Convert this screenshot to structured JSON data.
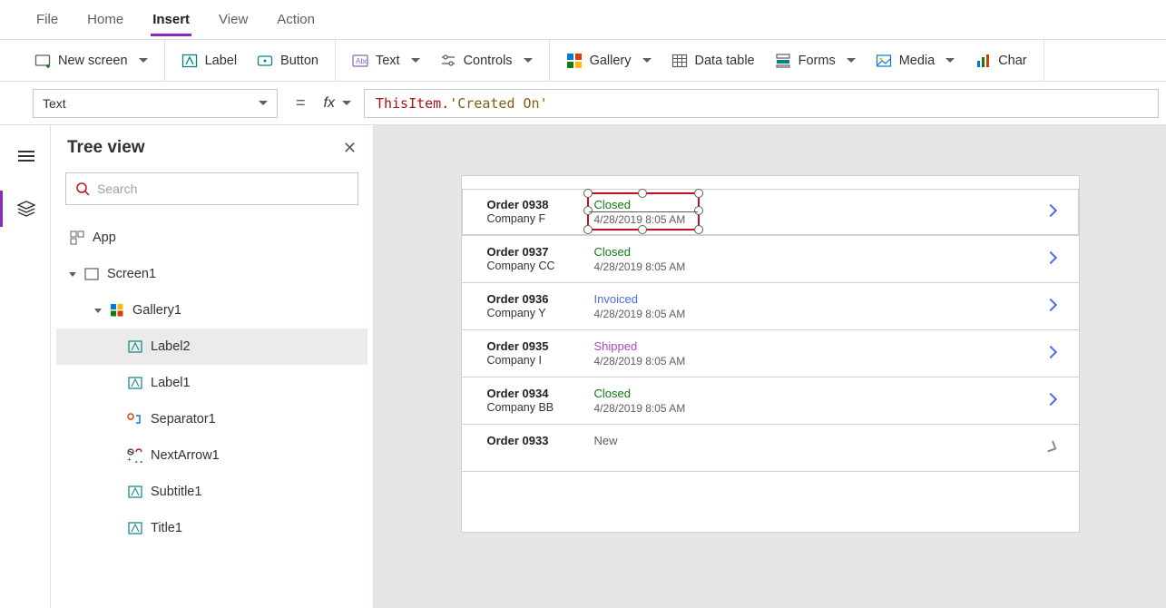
{
  "menubar": {
    "items": [
      {
        "label": "File"
      },
      {
        "label": "Home"
      },
      {
        "label": "Insert",
        "active": true
      },
      {
        "label": "View"
      },
      {
        "label": "Action"
      }
    ]
  },
  "ribbon": {
    "newScreen": "New screen",
    "label": "Label",
    "button": "Button",
    "text": "Text",
    "controls": "Controls",
    "gallery": "Gallery",
    "dataTable": "Data table",
    "forms": "Forms",
    "media": "Media",
    "charts": "Char"
  },
  "formula": {
    "property": "Text",
    "fx": "fx",
    "tokens": {
      "this": "ThisItem",
      "dot": ".",
      "field": "'Created On'"
    }
  },
  "tree": {
    "title": "Tree view",
    "searchPlaceholder": "Search",
    "nodes": {
      "app": "App",
      "screen1": "Screen1",
      "gallery1": "Gallery1",
      "label2": "Label2",
      "label1": "Label1",
      "separator1": "Separator1",
      "nextArrow1": "NextArrow1",
      "subtitle1": "Subtitle1",
      "title1": "Title1"
    }
  },
  "orders": [
    {
      "order": "Order 0938",
      "company": "Company F",
      "status": "Closed",
      "ts": "4/28/2019 8:05 AM",
      "selected": true
    },
    {
      "order": "Order 0937",
      "company": "Company CC",
      "status": "Closed",
      "ts": "4/28/2019 8:05 AM"
    },
    {
      "order": "Order 0936",
      "company": "Company Y",
      "status": "Invoiced",
      "ts": "4/28/2019 8:05 AM"
    },
    {
      "order": "Order 0935",
      "company": "Company I",
      "status": "Shipped",
      "ts": "4/28/2019 8:05 AM"
    },
    {
      "order": "Order 0934",
      "company": "Company BB",
      "status": "Closed",
      "ts": "4/28/2019 8:05 AM"
    },
    {
      "order": "Order 0933",
      "company": "",
      "status": "New",
      "ts": "",
      "last": true
    }
  ]
}
